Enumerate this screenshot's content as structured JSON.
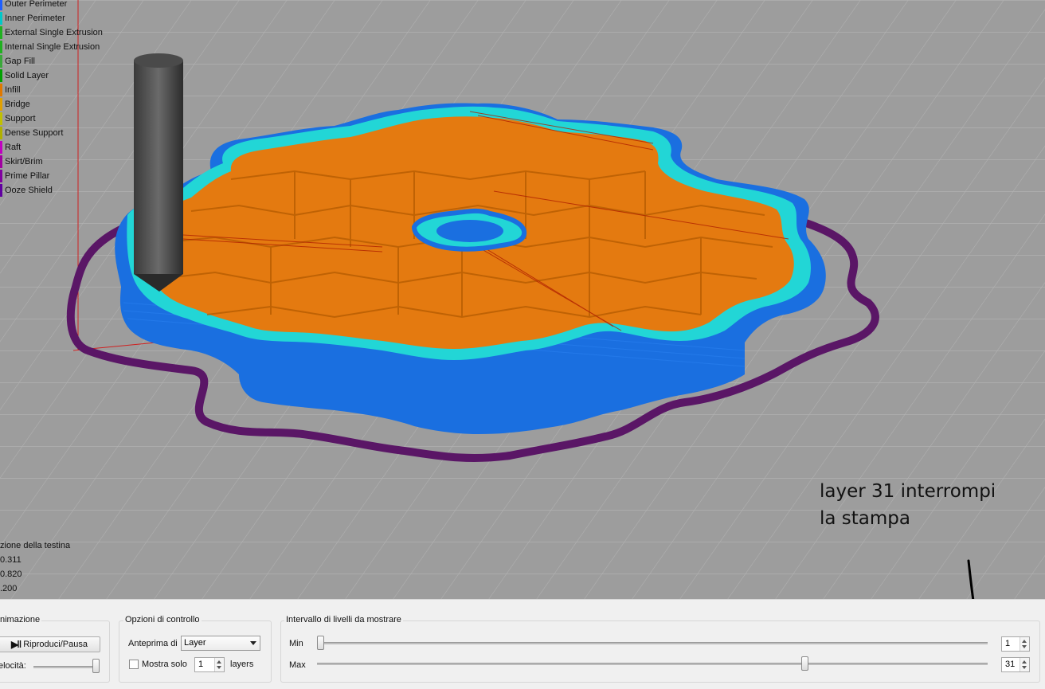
{
  "legend": {
    "items": [
      {
        "label": "Outer Perimeter",
        "color": "#1f5fff"
      },
      {
        "label": "Inner Perimeter",
        "color": "#00c8c8"
      },
      {
        "label": "External Single Extrusion",
        "color": "#20b020"
      },
      {
        "label": "Internal Single Extrusion",
        "color": "#20b020"
      },
      {
        "label": "Gap Fill",
        "color": "#3aa83a"
      },
      {
        "label": "Solid Layer",
        "color": "#00a000"
      },
      {
        "label": "Infill",
        "color": "#e07800"
      },
      {
        "label": "Bridge",
        "color": "#e0a000"
      },
      {
        "label": "Support",
        "color": "#c0c000"
      },
      {
        "label": "Dense Support",
        "color": "#b0b000"
      },
      {
        "label": "Raft",
        "color": "#c000c0"
      },
      {
        "label": "Skirt/Brim",
        "color": "#a000a0"
      },
      {
        "label": "Prime Pillar",
        "color": "#8000a0"
      },
      {
        "label": "Ooze Shield",
        "color": "#6000a0"
      }
    ]
  },
  "readout": {
    "title": "zione della testina",
    "values": [
      "0.311",
      "0.820",
      ".200"
    ]
  },
  "annotation": {
    "line1": "layer 31 interrompi",
    "line2": "la stampa"
  },
  "controls": {
    "animation": {
      "title": "nimazione",
      "play_label": "Riproduci/Pausa",
      "speed_label": "elocità:"
    },
    "options": {
      "title": "Opzioni di controllo",
      "preview_label": "Anteprima di",
      "preview_value": "Layer",
      "show_only_label": "Mostra solo",
      "show_only_value": "1",
      "layers_label": "layers"
    },
    "range": {
      "title": "Intervallo di livelli da mostrare",
      "min_label": "Min",
      "min_value": "1",
      "max_label": "Max",
      "max_value": "31",
      "max_fraction": 0.73
    }
  },
  "colors": {
    "viewport_bg": "#9d9d9d",
    "outer_perimeter": "#1a6fe0",
    "inner_perimeter": "#22d6d6",
    "infill": "#e47a10",
    "skirt": "#5a1666"
  }
}
